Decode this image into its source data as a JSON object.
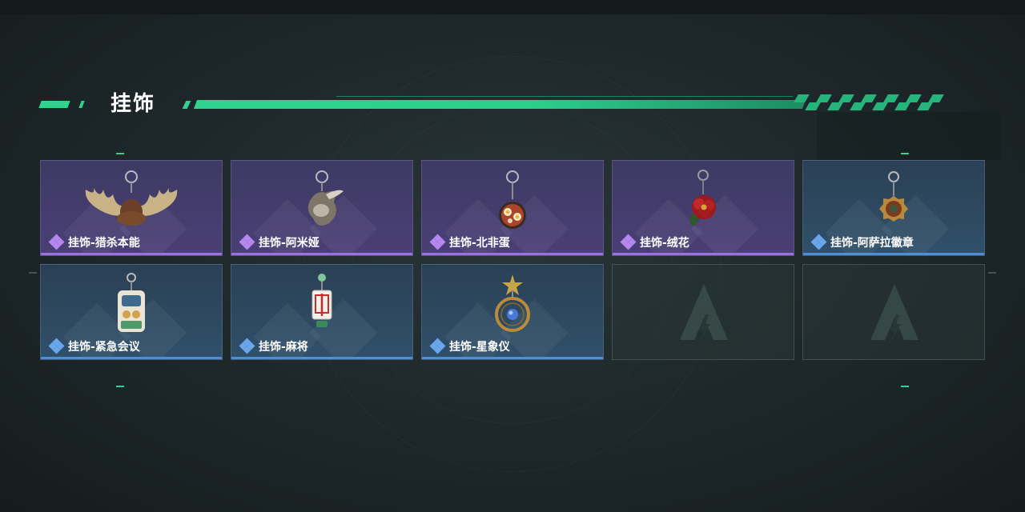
{
  "header": {
    "title": "挂饰"
  },
  "colors": {
    "accent": "#2fd38f",
    "rarity_purple": "#9d6fe0",
    "rarity_blue": "#4d8fd6"
  },
  "items": [
    {
      "label": "挂饰-猎杀本能",
      "rarity": "purple",
      "icon": "moose-antler-charm-icon"
    },
    {
      "label": "挂饰-阿米娅",
      "rarity": "purple",
      "icon": "rabbit-plush-charm-icon"
    },
    {
      "label": "挂饰-北非蛋",
      "rarity": "purple",
      "icon": "shakshuka-pan-charm-icon"
    },
    {
      "label": "挂饰-绒花",
      "rarity": "purple",
      "icon": "red-velvet-flower-charm-icon"
    },
    {
      "label": "挂饰-阿萨拉徽章",
      "rarity": "blue",
      "icon": "asala-badge-charm-icon"
    },
    {
      "label": "挂饰-紧急会议",
      "rarity": "blue",
      "icon": "emergency-meeting-charm-icon"
    },
    {
      "label": "挂饰-麻将",
      "rarity": "blue",
      "icon": "mahjong-tile-charm-icon"
    },
    {
      "label": "挂饰-星象仪",
      "rarity": "blue",
      "icon": "astrolabe-charm-icon"
    }
  ],
  "empty_slots": 2
}
